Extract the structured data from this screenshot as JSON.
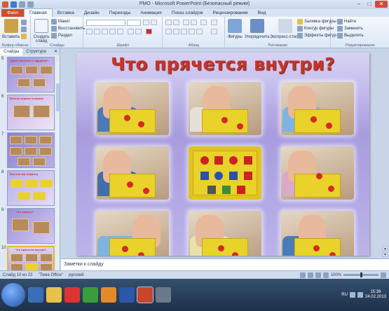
{
  "window": {
    "title": "PMO  -  Microsoft PowerPoint (Безопасный режим)",
    "minimize": "–",
    "maximize": "□",
    "close": "✕"
  },
  "ribbon_tabs": [
    "Файл",
    "Главная",
    "Вставка",
    "Дизайн",
    "Переходы",
    "Анимация",
    "Показ слайдов",
    "Рецензирование",
    "Вид"
  ],
  "ribbon": {
    "clipboard": {
      "paste": "Вставить",
      "group": "Буфер обмена"
    },
    "slides": {
      "new_slide": "Создать слайд",
      "layout": "Макет",
      "reset": "Восстановить",
      "section": "Раздел",
      "group": "Слайды"
    },
    "font": {
      "group": "Шрифт"
    },
    "paragraph": {
      "group": "Абзац"
    },
    "drawing": {
      "shapes": "Фигуры",
      "arrange": "Упорядочить",
      "quick_styles": "Экспресс-стили",
      "fill": "Заливка фигуры",
      "outline": "Контур фигуры",
      "effects": "Эффекты фигур",
      "group": "Рисование"
    },
    "editing": {
      "find": "Найти",
      "replace": "Заменить",
      "select": "Выделить",
      "group": "Редактирование"
    }
  },
  "left_panel": {
    "tab_slides": "Слайды",
    "tab_outline": "Структура",
    "close": "✕",
    "thumb_numbers": [
      "5",
      "6",
      "7",
      "8",
      "9",
      "10"
    ],
    "thumb_titles": [
      "Самое веселое и задорное!",
      "Весело играем и играем",
      "",
      "Выстои как образец",
      "Что сверху?",
      "Что прячется внутри?"
    ]
  },
  "slide": {
    "title": "Что прячется внутри?"
  },
  "notes": {
    "placeholder": "Заметки к слайду"
  },
  "status": {
    "slide_info": "Слайд 10 из 22",
    "theme": "\"Тема Office\"",
    "language": "русский",
    "zoom": "100%"
  },
  "taskbar": {
    "lang": "RU",
    "time": "15:36",
    "date": "24.02.2013"
  }
}
